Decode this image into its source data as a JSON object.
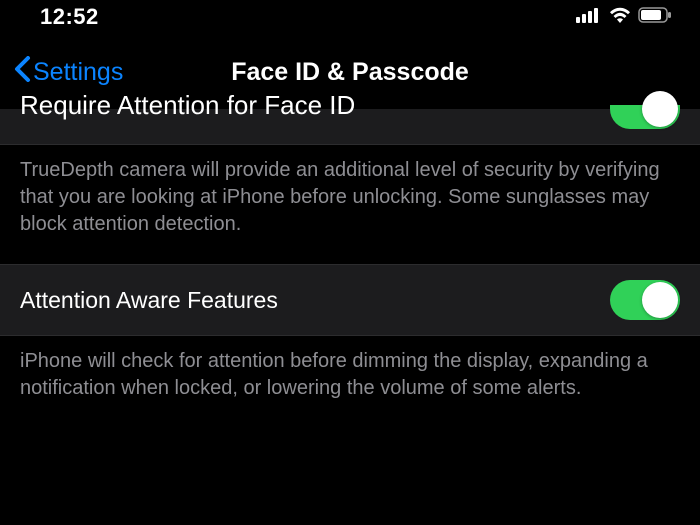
{
  "status": {
    "time": "12:52"
  },
  "nav": {
    "back_label": "Settings",
    "title": "Face ID & Passcode"
  },
  "colors": {
    "accent": "#0b84ff",
    "toggle_on": "#30d158",
    "row_bg": "#1c1c1e",
    "footer_text": "#8e8e93"
  },
  "sections": {
    "require_attention": {
      "label": "Require Attention for Face ID",
      "enabled": true,
      "description": "TrueDepth camera will provide an additional level of security by verifying that you are looking at iPhone before unlocking. Some sunglasses may block attention detection."
    },
    "attention_aware": {
      "label": "Attention Aware Features",
      "enabled": true,
      "description": "iPhone will check for attention before dimming the display, expanding a notification when locked, or lowering the volume of some alerts."
    }
  }
}
